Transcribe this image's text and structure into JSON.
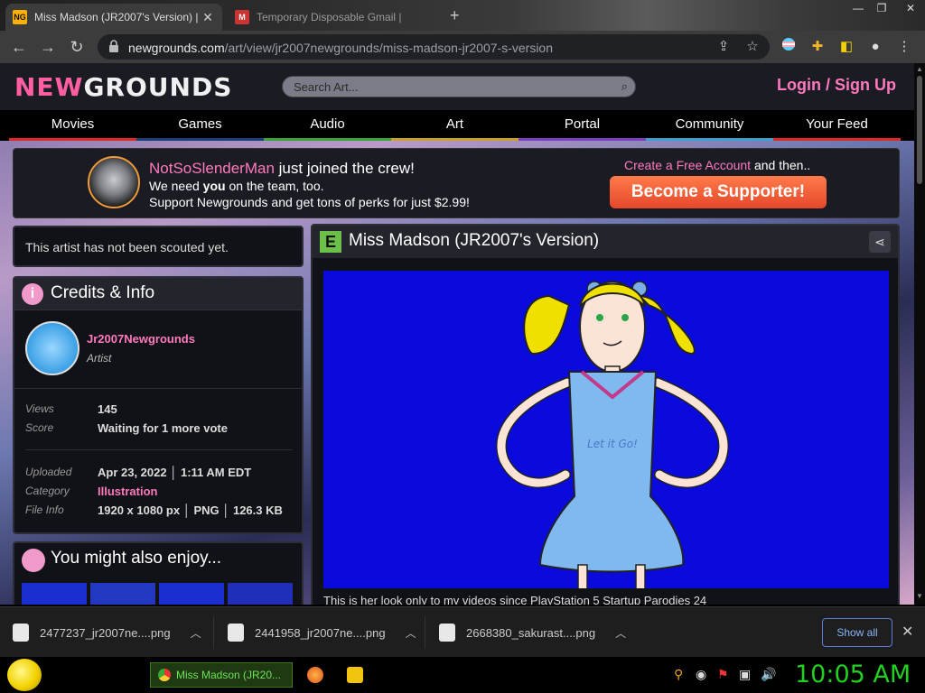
{
  "browser": {
    "tabs": [
      {
        "title": "Miss Madson (JR2007's Version) |",
        "active": true
      },
      {
        "title": "Temporary Disposable Gmail |",
        "active": false
      }
    ],
    "url_domain": "newgrounds.com",
    "url_path": "/art/view/jr2007newgrounds/miss-madson-jr2007-s-version"
  },
  "site": {
    "logo_a": "NEW",
    "logo_b": "GROUNDS",
    "search_placeholder": "Search Art...",
    "login": "Login / Sign Up",
    "nav": [
      {
        "label": "Movies",
        "color": "#e2262a"
      },
      {
        "label": "Games",
        "color": "#1a3f7a"
      },
      {
        "label": "Audio",
        "color": "#3aa33a"
      },
      {
        "label": "Art",
        "color": "#c9a227"
      },
      {
        "label": "Portal",
        "color": "#7b3fbf"
      },
      {
        "label": "Community",
        "color": "#3aa0d0"
      },
      {
        "label": "Your Feed",
        "color": "#e2262a"
      }
    ]
  },
  "promo": {
    "name": "NotSoSlenderMan",
    "joined": " just joined the crew!",
    "need_a": "We need ",
    "need_b": "you",
    "need_c": " on the team, too.",
    "support": "Support Newgrounds and get tons of perks for just $2.99!",
    "create_link": "Create a Free Account",
    "and_then": " and then..",
    "button": "Become a Supporter!"
  },
  "scout": "This artist has not been scouted yet.",
  "credits": {
    "title": "Credits & Info",
    "author": "Jr2007Newgrounds",
    "role": "Artist",
    "views_label": "Views",
    "views": "145",
    "score_label": "Score",
    "score": "Waiting for 1 more vote",
    "uploaded_label": "Uploaded",
    "uploaded_date": "Apr 23, 2022",
    "uploaded_time": "1:11 AM EDT",
    "category_label": "Category",
    "category": "Illustration",
    "fileinfo_label": "File Info",
    "dims": "1920 x 1080 px",
    "format": "PNG",
    "size": "126.3 KB"
  },
  "enjoy": {
    "title": "You might also enjoy..."
  },
  "art": {
    "title": "Miss Madson (JR2007's Version)",
    "shirt_text": "Let it Go!",
    "caption": "This is her look only to my videos since PlayStation 5 Startup Parodies 24"
  },
  "downloads": {
    "items": [
      "2477237_jr2007ne....png",
      "2441958_jr2007ne....png",
      "2668380_sakurast....png"
    ],
    "show_all": "Show all"
  },
  "taskbar": {
    "chrome_task": "Miss Madson (JR20...",
    "clock": "10:05 AM"
  }
}
